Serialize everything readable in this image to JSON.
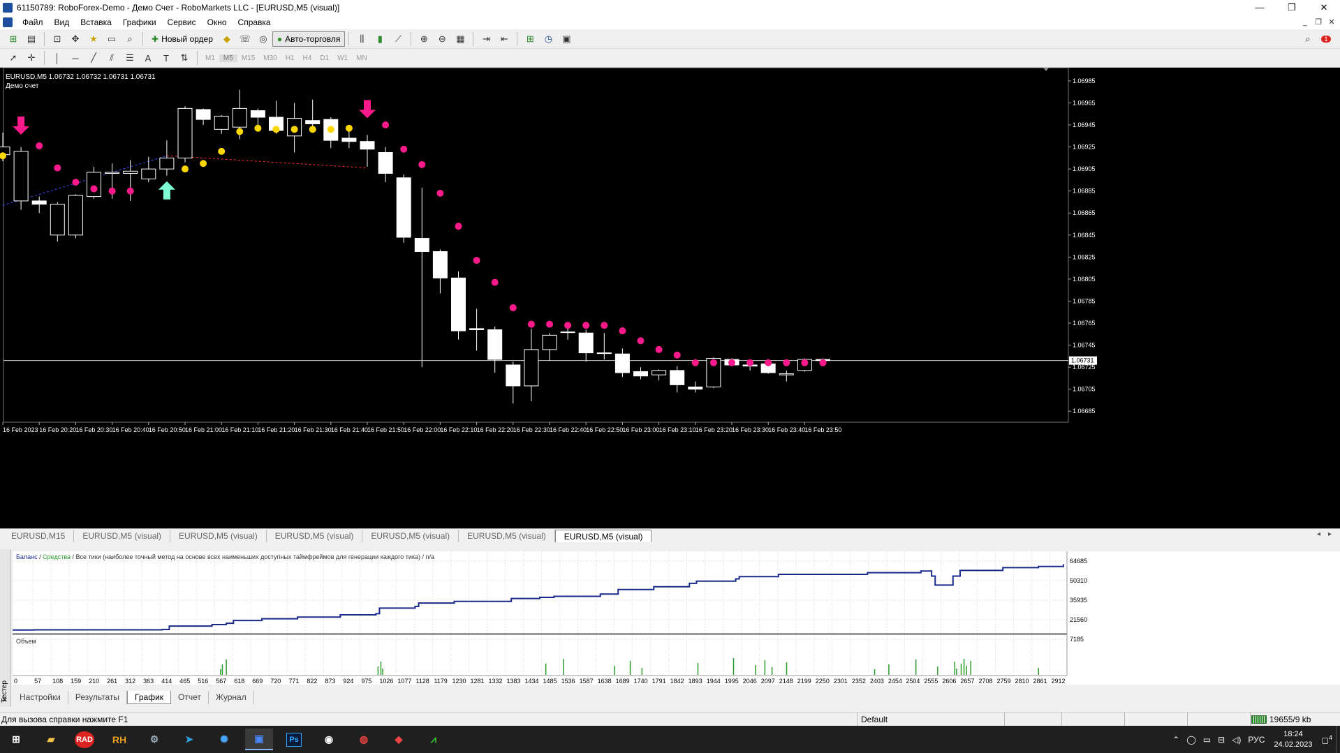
{
  "window": {
    "title": "61150789: RoboForex-Demo - Демо Счет - RoboMarkets LLC - [EURUSD,M5 (visual)]",
    "minimize": "—",
    "maximize": "❐",
    "close": "✕"
  },
  "menu": [
    "Файл",
    "Вид",
    "Вставка",
    "Графики",
    "Сервис",
    "Окно",
    "Справка"
  ],
  "mdi": {
    "minimize": "_",
    "restore": "❐",
    "close": "✕"
  },
  "toolbar1": {
    "new_order": "Новый ордер",
    "auto_trading": "Авто-торговля",
    "notif_count": "1"
  },
  "toolbar2": {
    "timeframes": [
      "M1",
      "M5",
      "M15",
      "M30",
      "H1",
      "H4",
      "D1",
      "W1",
      "MN"
    ],
    "text_tool": "A",
    "label_tool": "T"
  },
  "chart": {
    "info_line": "EURUSD,M5  1.06732 1.06732 1.06731 1.06731",
    "account_type": "Демо счет",
    "current_price": "1.06731",
    "colors": {
      "background": "#000000",
      "candle": "#ffffff",
      "buy_dot": "#ffd700",
      "sell_dot": "#ff1a8c",
      "up_arrow": "#7fffd4",
      "down_arrow": "#ff1a8c",
      "price_line": "#cccccc"
    }
  },
  "chart_data": {
    "type": "candlestick",
    "title": "EURUSD,M5",
    "y_ticks": [
      "1.06985",
      "1.06965",
      "1.06945",
      "1.06925",
      "1.06905",
      "1.06885",
      "1.06865",
      "1.06845",
      "1.06825",
      "1.06805",
      "1.06785",
      "1.06765",
      "1.06745",
      "1.06725",
      "1.06705",
      "1.06685"
    ],
    "ylim": [
      1.06675,
      1.06997
    ],
    "x_ticks": [
      "16 Feb 2023",
      "16 Feb 20:20",
      "16 Feb 20:30",
      "16 Feb 20:40",
      "16 Feb 20:50",
      "16 Feb 21:00",
      "16 Feb 21:10",
      "16 Feb 21:20",
      "16 Feb 21:30",
      "16 Feb 21:40",
      "16 Feb 21:50",
      "16 Feb 22:00",
      "16 Feb 22:10",
      "16 Feb 22:20",
      "16 Feb 22:30",
      "16 Feb 22:40",
      "16 Feb 22:50",
      "16 Feb 23:00",
      "16 Feb 23:10",
      "16 Feb 23:20",
      "16 Feb 23:30",
      "16 Feb 23:40",
      "16 Feb 23:50"
    ],
    "candles": [
      [
        1.06918,
        1.06938,
        1.06925,
        1.06912
      ],
      [
        1.06876,
        1.06925,
        1.06921,
        1.06868
      ],
      [
        1.06876,
        1.0688,
        1.06873,
        1.06865
      ],
      [
        1.06845,
        1.06875,
        1.06873,
        1.06839
      ],
      [
        1.06845,
        1.06882,
        1.06881,
        1.06842
      ],
      [
        1.0688,
        1.06907,
        1.06902,
        1.06878
      ],
      [
        1.06901,
        1.0691,
        1.06902,
        1.06878
      ],
      [
        1.06901,
        1.06913,
        1.06903,
        1.06876
      ],
      [
        1.06896,
        1.06916,
        1.06905,
        1.06893
      ],
      [
        1.06905,
        1.06931,
        1.06915,
        1.06899
      ],
      [
        1.06915,
        1.06962,
        1.0696,
        1.06911
      ],
      [
        1.06959,
        1.0696,
        1.0695,
        1.06945
      ],
      [
        1.06941,
        1.06954,
        1.06953,
        1.06937
      ],
      [
        1.06943,
        1.06977,
        1.0696,
        1.06932
      ],
      [
        1.06958,
        1.0696,
        1.06952,
        1.06942
      ],
      [
        1.06952,
        1.06967,
        1.0694,
        1.06937
      ],
      [
        1.06935,
        1.06965,
        1.06951,
        1.0692
      ],
      [
        1.06949,
        1.06968,
        1.06946,
        1.06944
      ],
      [
        1.0695,
        1.06952,
        1.06931,
        1.06924
      ],
      [
        1.06933,
        1.0694,
        1.0693,
        1.06924
      ],
      [
        1.0693,
        1.06936,
        1.06923,
        1.06907
      ],
      [
        1.0692,
        1.06925,
        1.06901,
        1.06893
      ],
      [
        1.06897,
        1.069,
        1.06843,
        1.06838
      ],
      [
        1.06842,
        1.06888,
        1.0683,
        1.06725
      ],
      [
        1.0683,
        1.06832,
        1.06806,
        1.06792
      ],
      [
        1.06806,
        1.06812,
        1.06758,
        1.0675
      ],
      [
        1.0676,
        1.06778,
        1.06759,
        1.0674
      ],
      [
        1.06759,
        1.06762,
        1.06732,
        1.0672
      ],
      [
        1.06727,
        1.0673,
        1.06708,
        1.06692
      ],
      [
        1.06708,
        1.0676,
        1.06741,
        1.06694
      ],
      [
        1.06741,
        1.06756,
        1.06754,
        1.06731
      ],
      [
        1.06757,
        1.06762,
        1.06757,
        1.0675
      ],
      [
        1.06756,
        1.06759,
        1.06738,
        1.0673
      ],
      [
        1.06738,
        1.06756,
        1.06738,
        1.06732
      ],
      [
        1.06737,
        1.06742,
        1.0672,
        1.06716
      ],
      [
        1.06721,
        1.06725,
        1.06717,
        1.06714
      ],
      [
        1.06718,
        1.06723,
        1.06722,
        1.06713
      ],
      [
        1.06722,
        1.06726,
        1.06709,
        1.06702
      ],
      [
        1.06707,
        1.06712,
        1.06705,
        1.06702
      ],
      [
        1.06707,
        1.06734,
        1.06733,
        1.06706
      ],
      [
        1.06732,
        1.06733,
        1.06727,
        1.06727
      ],
      [
        1.06727,
        1.0673,
        1.06726,
        1.06722
      ],
      [
        1.06728,
        1.06729,
        1.0672,
        1.06719
      ],
      [
        1.06718,
        1.06722,
        1.06719,
        1.06712
      ],
      [
        1.06722,
        1.06733,
        1.06732,
        1.06721
      ],
      [
        1.06732,
        1.06733,
        1.06731,
        1.06731
      ]
    ],
    "buy_dots": [
      [
        0,
        1.06917
      ],
      [
        10,
        1.06905
      ],
      [
        11,
        1.0691
      ],
      [
        12,
        1.06921
      ],
      [
        13,
        1.06939
      ],
      [
        14,
        1.06942
      ],
      [
        15,
        1.06941
      ],
      [
        16,
        1.06941
      ],
      [
        17,
        1.06941
      ],
      [
        18,
        1.06941
      ],
      [
        19,
        1.06942
      ]
    ],
    "sell_dots": [
      [
        2,
        1.06926
      ],
      [
        3,
        1.06906
      ],
      [
        4,
        1.06893
      ],
      [
        5,
        1.06887
      ],
      [
        6,
        1.06885
      ],
      [
        7,
        1.06885
      ],
      [
        21,
        1.06945
      ],
      [
        22,
        1.06923
      ],
      [
        23,
        1.06909
      ],
      [
        24,
        1.06883
      ],
      [
        25,
        1.06853
      ],
      [
        26,
        1.06822
      ],
      [
        27,
        1.06802
      ],
      [
        28,
        1.06779
      ],
      [
        29,
        1.06764
      ],
      [
        30,
        1.06764
      ],
      [
        31,
        1.06763
      ],
      [
        32,
        1.06763
      ],
      [
        33,
        1.06763
      ],
      [
        34,
        1.06758
      ],
      [
        35,
        1.06749
      ],
      [
        36,
        1.06741
      ],
      [
        37,
        1.06736
      ],
      [
        38,
        1.06729
      ],
      [
        39,
        1.06729
      ],
      [
        40,
        1.06729
      ],
      [
        41,
        1.06729
      ],
      [
        42,
        1.06729
      ],
      [
        43,
        1.06729
      ],
      [
        44,
        1.06729
      ],
      [
        45,
        1.06729
      ]
    ],
    "up_arrows": [
      [
        9,
        1.06885
      ]
    ],
    "down_arrows": [
      [
        1,
        1.06945
      ],
      [
        20,
        1.0696
      ]
    ],
    "trade_lines": [
      {
        "from": [
          0,
          1.06872
        ],
        "to": [
          9,
          1.06917
        ],
        "color": "#3a4dff"
      },
      {
        "from": [
          9,
          1.06917
        ],
        "to": [
          20,
          1.06906
        ],
        "color": "#ff3030"
      }
    ]
  },
  "chart_tabs": [
    "EURUSD,M15",
    "EURUSD,M5 (visual)",
    "EURUSD,M5 (visual)",
    "EURUSD,M5 (visual)",
    "EURUSD,M5 (visual)",
    "EURUSD,M5 (visual)",
    "EURUSD,M5 (visual)"
  ],
  "tester": {
    "side_label": "Тестер",
    "legend_balance": "Баланс",
    "legend_sep": " / ",
    "legend_equity": "Средства",
    "legend_rest": " / Все тики (наиболее точный метод на основе всех наименьших доступных таймфреймов для генерации каждого тика) / n/a",
    "volume_label": "Объем",
    "y_ticks": [
      "64685",
      "50310",
      "35935",
      "21560",
      "7185"
    ],
    "x_ticks": [
      "0",
      "57",
      "108",
      "159",
      "210",
      "261",
      "312",
      "363",
      "414",
      "465",
      "516",
      "567",
      "618",
      "669",
      "720",
      "771",
      "822",
      "873",
      "924",
      "975",
      "1026",
      "1077",
      "1128",
      "1179",
      "1230",
      "1281",
      "1332",
      "1383",
      "1434",
      "1485",
      "1536",
      "1587",
      "1638",
      "1689",
      "1740",
      "1791",
      "1842",
      "1893",
      "1944",
      "1995",
      "2046",
      "2097",
      "2148",
      "2199",
      "2250",
      "2301",
      "2352",
      "2403",
      "2454",
      "2504",
      "2555",
      "2606",
      "2657",
      "2708",
      "2759",
      "2810",
      "2861",
      "2912"
    ],
    "tabs": [
      "Настройки",
      "Результаты",
      "График",
      "Отчет",
      "Журнал"
    ],
    "active_tab": "График"
  },
  "tester_chart_data": {
    "type": "line",
    "xlim": [
      0,
      2960
    ],
    "ylim": [
      0,
      72000
    ],
    "balance": [
      [
        0,
        2000
      ],
      [
        60,
        2200
      ],
      [
        420,
        2500
      ],
      [
        440,
        5500
      ],
      [
        560,
        6800
      ],
      [
        600,
        8000
      ],
      [
        620,
        10500
      ],
      [
        700,
        12000
      ],
      [
        800,
        13500
      ],
      [
        920,
        15500
      ],
      [
        1020,
        16500
      ],
      [
        1030,
        21500
      ],
      [
        1130,
        23000
      ],
      [
        1140,
        26000
      ],
      [
        1240,
        27500
      ],
      [
        1400,
        30000
      ],
      [
        1480,
        31000
      ],
      [
        1520,
        32000
      ],
      [
        1650,
        34000
      ],
      [
        1700,
        38000
      ],
      [
        1800,
        40500
      ],
      [
        1900,
        43500
      ],
      [
        1920,
        45500
      ],
      [
        2030,
        47500
      ],
      [
        2040,
        49500
      ],
      [
        2150,
        51500
      ],
      [
        2400,
        53000
      ],
      [
        2550,
        54500
      ],
      [
        2580,
        50000
      ],
      [
        2590,
        42000
      ],
      [
        2640,
        50000
      ],
      [
        2660,
        55000
      ],
      [
        2780,
        57500
      ],
      [
        2880,
        58500
      ],
      [
        2950,
        60500
      ]
    ],
    "volume_bars": [
      584,
      589,
      600,
      1026,
      1034,
      1039,
      1497,
      1547,
      1690,
      1734,
      1767,
      1924,
      2024,
      2086,
      2112,
      2132,
      2173,
      2420,
      2460,
      2536,
      2597,
      2645,
      2650,
      2663,
      2671,
      2678,
      2690,
      2880
    ]
  },
  "statusbar": {
    "hint": "Для вызова справки нажмите F1",
    "profile": "Default",
    "traffic": "19655/9 kb"
  },
  "taskbar": {
    "apps": [
      "start",
      "file-explorer",
      "RAD",
      "RH",
      "gear",
      "telegram",
      "network",
      "metatrader",
      "Ps",
      "record",
      "chrome",
      "anydesk",
      "chart-app"
    ],
    "lang": "РУС",
    "time": "18:24",
    "date": "24.02.2023",
    "notif_count": "4"
  }
}
